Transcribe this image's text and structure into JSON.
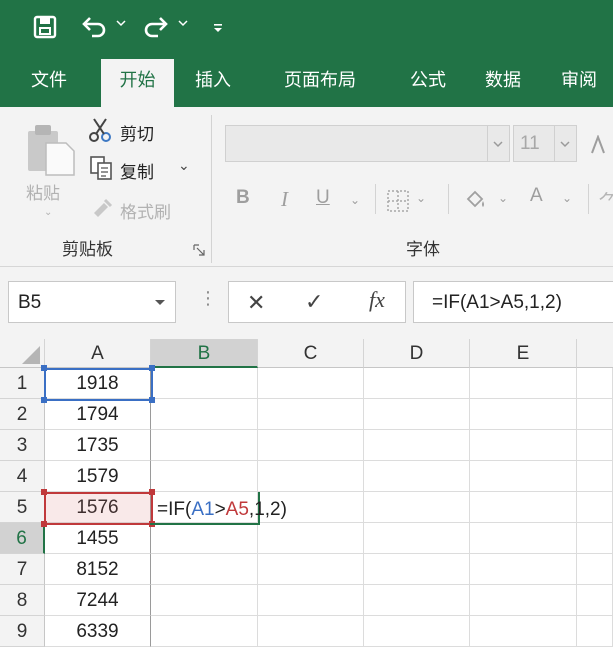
{
  "quick_access": {
    "items": [
      {
        "name": "save-icon"
      },
      {
        "name": "undo-icon"
      },
      {
        "name": "redo-icon"
      },
      {
        "name": "customize-icon"
      }
    ]
  },
  "tabs": [
    "文件",
    "开始",
    "插入",
    "页面布局",
    "公式",
    "数据",
    "审阅"
  ],
  "active_tab": "开始",
  "ribbon": {
    "clipboard": {
      "paste_label": "粘贴",
      "cut_label": "剪切",
      "copy_label": "复制",
      "format_painter_label": "格式刷",
      "group_label": "剪贴板"
    },
    "font": {
      "font_name": "",
      "font_size": "11",
      "bold_label": "B",
      "italic_label": "I",
      "underline_label": "U",
      "font_color_label": "A",
      "group_label": "字体"
    }
  },
  "formula_bar": {
    "name_box": "B5",
    "cancel_glyph": "✕",
    "enter_glyph": "✓",
    "fx_label": "fx",
    "formula": "=IF(A1>A5,1,2)"
  },
  "columns": [
    "A",
    "B",
    "C",
    "D",
    "E"
  ],
  "selected_column": "B",
  "rows": [
    {
      "row": "1",
      "a": "1918"
    },
    {
      "row": "2",
      "a": "1794"
    },
    {
      "row": "3",
      "a": "1735"
    },
    {
      "row": "4",
      "a": "1579"
    },
    {
      "row": "5",
      "a": "1576"
    },
    {
      "row": "6",
      "a": "1455"
    },
    {
      "row": "7",
      "a": "8152"
    },
    {
      "row": "8",
      "a": "7244"
    },
    {
      "row": "9",
      "a": "6339"
    }
  ],
  "selected_row": "6",
  "edit_cell": {
    "prefix": "=IF(",
    "ref1": "A1",
    "op": ">",
    "ref2": "A5",
    "suffix": ",1,2)"
  },
  "colors": {
    "accent": "#217346",
    "ref1": "#3a6fc4",
    "ref2": "#c0393b"
  }
}
